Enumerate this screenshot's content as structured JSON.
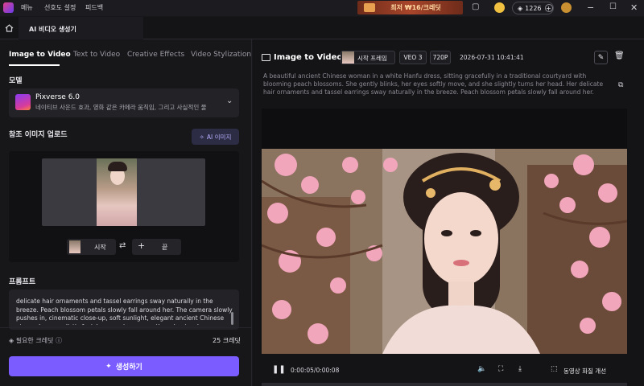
{
  "titlebar": {
    "menu": [
      "메뉴",
      "선호도 설정",
      "피드백"
    ],
    "promo": "최저 ₩16/크레딧",
    "credits": "1226",
    "window_controls": [
      "minimize-icon",
      "maximize-icon",
      "close-icon"
    ]
  },
  "tabs": {
    "app_tab": "AI 비디오 생성기"
  },
  "left": {
    "mode_tabs": [
      "Image to Video",
      "Text to Video",
      "Creative Effects",
      "Video Stylization"
    ],
    "model_label": "모델",
    "model_name": "Pixverse 6.0",
    "model_desc": "네이티브 사운드 효과, 영화 같은 카메라 움직임, 그리고 사실적인 물",
    "upload_label": "참조 이미지 업로드",
    "ai_image_button": "AI 이미지",
    "start_frame": "시작",
    "end_frame": "끝",
    "prompt_label": "프롬프트",
    "prompt_text": "delicate hair ornaments and tassel earrings sway naturally in the breeze. Peach blossom petals slowly fall around her. The camera slowly pushes in, cinematic close-up, soft sunlight, elegant ancient Chinese atmosphere, realistic facial expressions, smooth and natural movement.",
    "required_credits_label": "필요한 크레딧",
    "required_credits_value": "25 크레딧",
    "generate_button": "생성하기"
  },
  "right": {
    "title": "Image to Video",
    "badge_frame": "시작 프레임",
    "badge_model": "VEO 3",
    "badge_resolution": "720P",
    "timestamp": "2026-07-31 10:41:41",
    "description": "A beautiful ancient Chinese woman in a white Hanfu dress, sitting gracefully in a traditional courtyard with blooming peach blossoms. She gently blinks, her eyes softly move, and she slightly turns her head. Her delicate hair ornaments and tassel earrings sway naturally in the breeze. Peach blossom petals slowly fall around her. The camera slowly pushes in, cinematic close-up, soft sunlight, elegant ancient Chinese atmosphere, realistic facial",
    "time": "0:00:05/0:00:08",
    "enhance_label": "동영상 화질 개선",
    "progress": 0.0
  },
  "colors": {
    "accent": "#7a5cff",
    "bg": "#17171a"
  }
}
